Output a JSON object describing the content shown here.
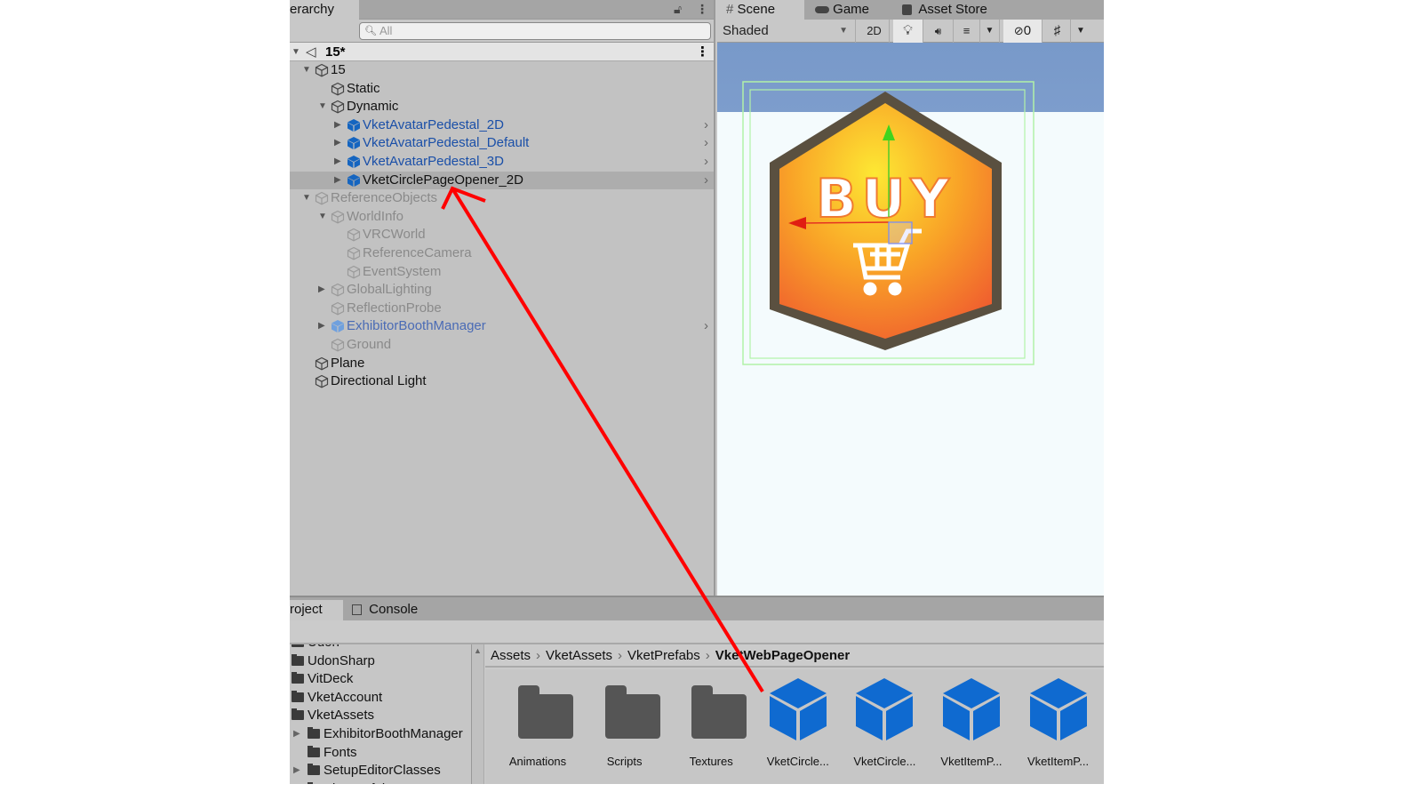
{
  "hierarchy": {
    "tab_label": "erarchy",
    "search_placeholder": "All",
    "scene_name": "15*",
    "items": [
      {
        "label": "15",
        "depth": 1,
        "arrow": "down",
        "kind": "normal"
      },
      {
        "label": "Static",
        "depth": 2,
        "arrow": "",
        "kind": "normal"
      },
      {
        "label": "Dynamic",
        "depth": 2,
        "arrow": "down",
        "kind": "normal"
      },
      {
        "label": "VketAvatarPedestal_2D",
        "depth": 3,
        "arrow": "right",
        "kind": "prefab",
        "chevron": true
      },
      {
        "label": "VketAvatarPedestal_Default",
        "depth": 3,
        "arrow": "right",
        "kind": "prefab",
        "chevron": true
      },
      {
        "label": "VketAvatarPedestal_3D",
        "depth": 3,
        "arrow": "right",
        "kind": "prefab",
        "chevron": true
      },
      {
        "label": "VketCirclePageOpener_2D",
        "depth": 3,
        "arrow": "right",
        "kind": "prefab-selected",
        "chevron": true
      },
      {
        "label": "ReferenceObjects",
        "depth": 1,
        "arrow": "down",
        "kind": "dim"
      },
      {
        "label": "WorldInfo",
        "depth": 2,
        "arrow": "down",
        "kind": "dim"
      },
      {
        "label": "VRCWorld",
        "depth": 3,
        "arrow": "",
        "kind": "dim"
      },
      {
        "label": "ReferenceCamera",
        "depth": 3,
        "arrow": "",
        "kind": "dim"
      },
      {
        "label": "EventSystem",
        "depth": 3,
        "arrow": "",
        "kind": "dim"
      },
      {
        "label": "GlobalLighting",
        "depth": 2,
        "arrow": "right",
        "kind": "dim"
      },
      {
        "label": "ReflectionProbe",
        "depth": 2,
        "arrow": "",
        "kind": "dim"
      },
      {
        "label": "ExhibitorBoothManager",
        "depth": 2,
        "arrow": "right",
        "kind": "dimprefab",
        "chevron": true
      },
      {
        "label": "Ground",
        "depth": 2,
        "arrow": "",
        "kind": "dim"
      },
      {
        "label": "Plane",
        "depth": 1,
        "arrow": "",
        "kind": "normal"
      },
      {
        "label": "Directional Light",
        "depth": 1,
        "arrow": "",
        "kind": "normal"
      }
    ]
  },
  "scene": {
    "tabs": [
      {
        "label": "Scene",
        "icon": "#"
      },
      {
        "label": "Game",
        "icon": "gamepad"
      },
      {
        "label": "Asset Store",
        "icon": "bag"
      }
    ],
    "shading_mode": "Shaded",
    "toggle_2d": "2D",
    "hidden_count": "0",
    "badge_text": "BUY"
  },
  "project": {
    "tabs": [
      {
        "label": "roject"
      },
      {
        "label": "Console"
      }
    ],
    "folders": [
      {
        "label": "Udon",
        "depth": 0,
        "arrow": ""
      },
      {
        "label": "UdonSharp",
        "depth": 0,
        "arrow": ""
      },
      {
        "label": "VitDeck",
        "depth": 0,
        "arrow": ""
      },
      {
        "label": "VketAccount",
        "depth": 0,
        "arrow": ""
      },
      {
        "label": "VketAssets",
        "depth": 0,
        "arrow": "open"
      },
      {
        "label": "ExhibitorBoothManager",
        "depth": 1,
        "arrow": "right"
      },
      {
        "label": "Fonts",
        "depth": 1,
        "arrow": ""
      },
      {
        "label": "SetupEditorClasses",
        "depth": 1,
        "arrow": "right"
      },
      {
        "label": "VketPrefabs",
        "depth": 1,
        "arrow": ""
      }
    ],
    "breadcrumb": [
      "Assets",
      "VketAssets",
      "VketPrefabs",
      "VketWebPageOpener"
    ],
    "assets": [
      {
        "label": "Animations",
        "type": "folder"
      },
      {
        "label": "Scripts",
        "type": "folder"
      },
      {
        "label": "Textures",
        "type": "folder"
      },
      {
        "label": "VketCircle...",
        "type": "prefab"
      },
      {
        "label": "VketCircle...",
        "type": "prefab"
      },
      {
        "label": "VketItemP...",
        "type": "prefab"
      },
      {
        "label": "VketItemP...",
        "type": "prefab"
      }
    ]
  },
  "colors": {
    "prefab_blue": "#1565c0",
    "annotation_red": "#ff0000"
  }
}
